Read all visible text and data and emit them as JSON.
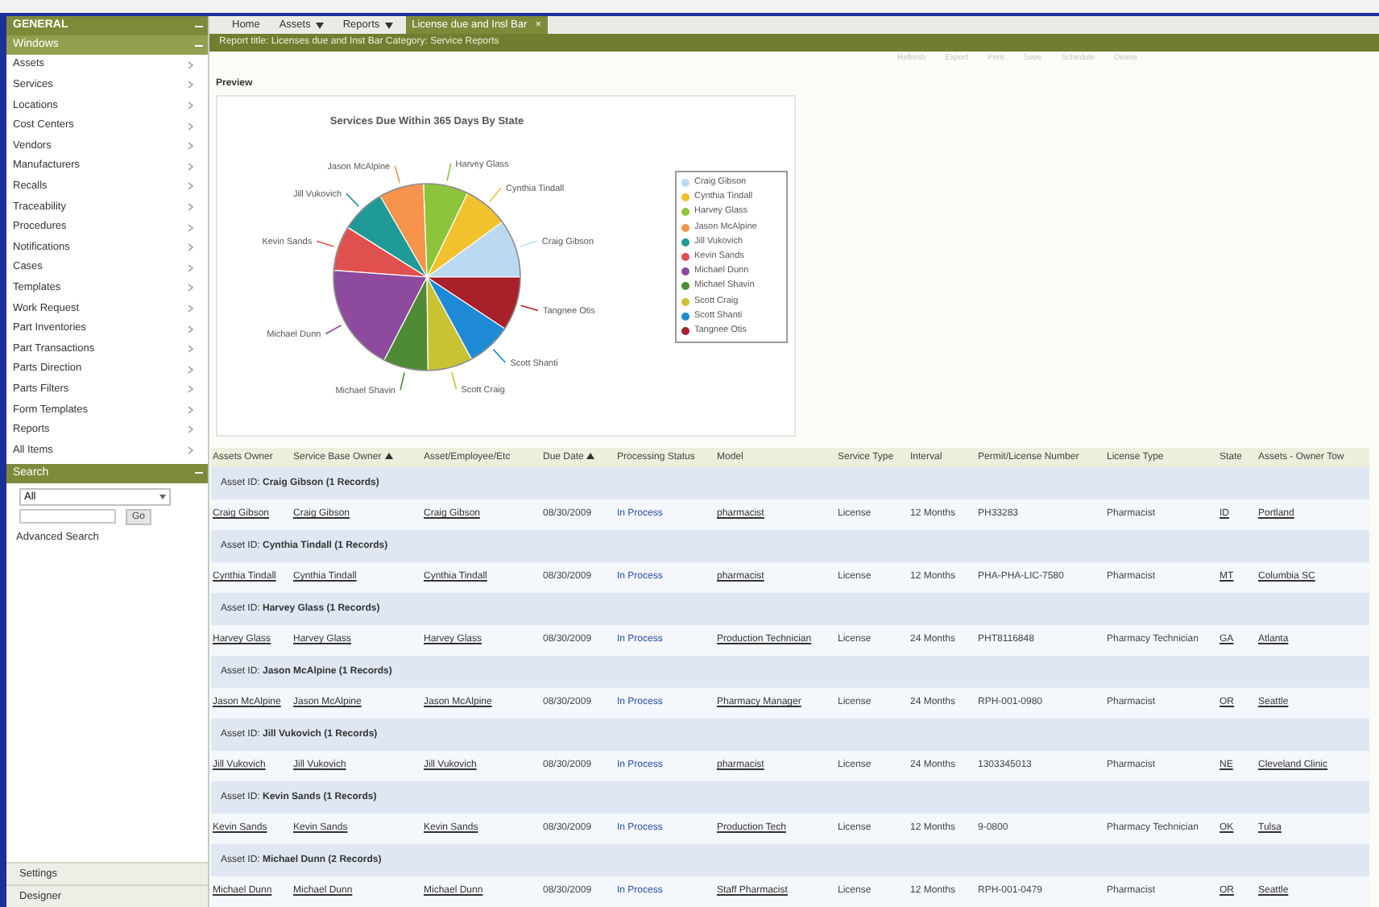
{
  "sidebar": {
    "header": "GENERAL",
    "section": "Windows",
    "items": [
      "Assets",
      "Services",
      "Locations",
      "Cost Centers",
      "Vendors",
      "Manufacturers",
      "Recalls",
      "Traceability",
      "Procedures",
      "Notifications",
      "Cases",
      "Templates",
      "Work Request",
      "Part Inventories",
      "Part Transactions",
      "Parts Direction",
      "Parts Filters",
      "Form Templates",
      "Reports",
      "All Items"
    ],
    "search": {
      "title": "Search",
      "scope": "All",
      "button": "Go",
      "advanced": "Advanced Search"
    },
    "footer": [
      "Settings",
      "Designer"
    ]
  },
  "tabs": [
    {
      "label": "Home",
      "menu": false,
      "selected": false
    },
    {
      "label": "Assets",
      "menu": true,
      "selected": false
    },
    {
      "label": "Reports",
      "menu": true,
      "selected": false
    },
    {
      "label": "License due and Insl Bar",
      "menu": false,
      "selected": true,
      "close": "×"
    }
  ],
  "report_bar": "Report title: Licenses due and Inst Bar  Category: Service Reports",
  "toolbar": [
    "Refresh",
    "Export",
    "Print",
    "Save",
    "Schedule",
    "Delete"
  ],
  "preview": {
    "label": "Preview",
    "title": "Services Due Within 365 Days By State",
    "slices": [
      {
        "label": "Craig Gibson",
        "color": "#bcd9f2"
      },
      {
        "label": "Cynthia Tindall",
        "color": "#f2c12e"
      },
      {
        "label": "Harvey Glass",
        "color": "#8cc43c"
      },
      {
        "label": "Jason McAlpine",
        "color": "#f5944a"
      },
      {
        "label": "Jill Vukovich",
        "color": "#1f9a96"
      },
      {
        "label": "Kevin Sands",
        "color": "#e0504e"
      },
      {
        "label": "Michael Dunn",
        "color": "#8e4a9c"
      },
      {
        "label": "Michael Shavin",
        "color": "#4f8a34"
      },
      {
        "label": "Scott Craig",
        "color": "#c9c232"
      },
      {
        "label": "Scott Shanti",
        "color": "#1e8ad6"
      },
      {
        "label": "Tangnee Otis",
        "color": "#a8202a"
      }
    ],
    "legend": [
      {
        "name": "Craig Gibson",
        "color": "#bcd9f2"
      },
      {
        "name": "Cynthia Tindall",
        "color": "#f2c12e"
      },
      {
        "name": "Harvey Glass",
        "color": "#8cc43c"
      },
      {
        "name": "Jason McAlpine",
        "color": "#f5944a"
      },
      {
        "name": "Jill Vukovich",
        "color": "#1f9a96"
      },
      {
        "name": "Kevin Sands",
        "color": "#e0504e"
      },
      {
        "name": "Michael Dunn",
        "color": "#8e4a9c"
      },
      {
        "name": "Michael Shavin",
        "color": "#4f8a34"
      },
      {
        "name": "Scott Craig",
        "color": "#c9c232"
      },
      {
        "name": "Scott Shanti",
        "color": "#1e8ad6"
      },
      {
        "name": "Tangnee Otis",
        "color": "#a8202a"
      }
    ]
  },
  "table": {
    "columns": [
      {
        "label": "Assets Owner",
        "sorted": false,
        "kind": "link"
      },
      {
        "label": "Service Base Owner",
        "sorted": true,
        "kind": "link"
      },
      {
        "label": "Asset/Employee/Etc",
        "sorted": false,
        "kind": "link"
      },
      {
        "label": "Due Date",
        "sorted": true,
        "kind": "plain"
      },
      {
        "label": "Processing Status",
        "sorted": false,
        "kind": "status"
      },
      {
        "label": "Model",
        "sorted": false,
        "kind": "link"
      },
      {
        "label": "Service Type",
        "sorted": false,
        "kind": "plain"
      },
      {
        "label": "Interval",
        "sorted": false,
        "kind": "plain"
      },
      {
        "label": "Permit/License Number",
        "sorted": false,
        "kind": "plain"
      },
      {
        "label": "License Type",
        "sorted": false,
        "kind": "plain"
      },
      {
        "label": "State",
        "sorted": false,
        "kind": "link"
      },
      {
        "label": "Assets - Owner Tow",
        "sorted": false,
        "kind": "link"
      }
    ],
    "groups": [
      {
        "title": "Asset ID: **Craig Gibson (1 Records)**",
        "rows": [
          [
            "Craig Gibson",
            "Craig Gibson",
            "Craig Gibson",
            "08/30/2009",
            "In Process",
            "pharmacist",
            "License",
            "12 Months",
            "PH33283",
            "Pharmacist",
            "ID",
            "Portland"
          ]
        ]
      },
      {
        "title": "Asset ID: **Cynthia Tindall (1 Records)**",
        "rows": [
          [
            "Cynthia Tindall",
            "Cynthia Tindall",
            "Cynthia Tindall",
            "08/30/2009",
            "In Process",
            "pharmacist",
            "License",
            "12 Months",
            "PHA-PHA-LIC-7580",
            "Pharmacist",
            "MT",
            "Columbia SC"
          ]
        ]
      },
      {
        "title": "Asset ID: **Harvey Glass (1 Records)**",
        "rows": [
          [
            "Harvey Glass",
            "Harvey Glass",
            "Harvey Glass",
            "08/30/2009",
            "In Process",
            "Production Technician",
            "License",
            "24 Months",
            "PHT8116848",
            "Pharmacy Technician",
            "GA",
            "Atlanta"
          ]
        ]
      },
      {
        "title": "Asset ID: **Jason McAlpine (1 Records)**",
        "rows": [
          [
            "Jason McAlpine",
            "Jason McAlpine",
            "Jason McAlpine",
            "08/30/2009",
            "In Process",
            "Pharmacy Manager",
            "License",
            "24 Months",
            "RPH-001-0980",
            "Pharmacist",
            "OR",
            "Seattle"
          ]
        ]
      },
      {
        "title": "Asset ID: **Jill Vukovich (1 Records)**",
        "rows": [
          [
            "Jill Vukovich",
            "Jill Vukovich",
            "Jill Vukovich",
            "08/30/2009",
            "In Process",
            "pharmacist",
            "License",
            "24 Months",
            "1303345013",
            "Pharmacist",
            "NE",
            "Cleveland Clinic"
          ]
        ]
      },
      {
        "title": "Asset ID: **Kevin Sands (1 Records)**",
        "rows": [
          [
            "Kevin Sands",
            "Kevin Sands",
            "Kevin Sands",
            "08/30/2009",
            "In Process",
            "Production Tech",
            "License",
            "12 Months",
            "9-0800",
            "Pharmacy Technician",
            "OK",
            "Tulsa"
          ]
        ]
      },
      {
        "title": "Asset ID: **Michael Dunn (2 Records)**",
        "rows": [
          [
            "Michael Dunn",
            "Michael Dunn",
            "Michael Dunn",
            "08/30/2009",
            "In Process",
            "Staff Pharmacist",
            "License",
            "12 Months",
            "RPH-001-0479",
            "Pharmacist",
            "OR",
            "Seattle"
          ]
        ]
      }
    ]
  }
}
